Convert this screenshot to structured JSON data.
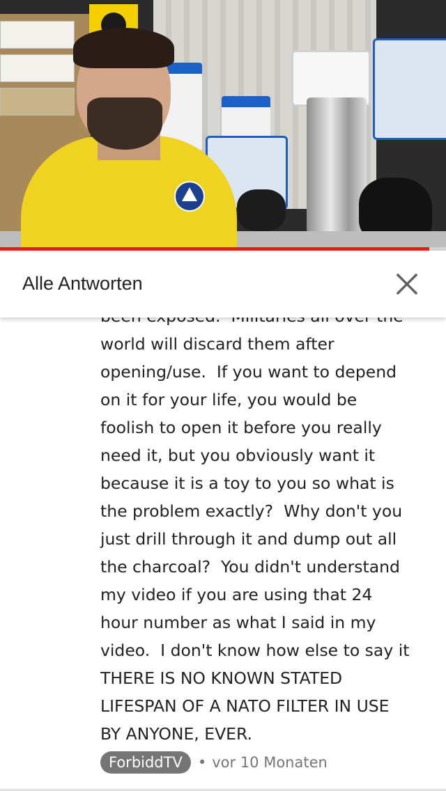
{
  "video": {
    "progress_fraction": 0.963,
    "progress_color": "#e62117"
  },
  "header": {
    "title": "Alle Antworten",
    "close_icon": "close-icon"
  },
  "comment": {
    "partial_top_line": "been exposed.  Militaries all over the",
    "lines": [
      "world will discard them after",
      "opening/use.  If you want to depend",
      "on it for your life, you would be",
      "foolish to open it before you really",
      "need it, but you obviously want it",
      "because it is a toy to you so what is",
      "the problem exactly?  Why don't you",
      "just drill through it and dump out all",
      "the charcoal?  You didn't understand",
      "my video if you are using that 24",
      "hour number as what I said in my",
      "video.  I don't know how else to say it",
      "THERE IS NO KNOWN STATED",
      "LIFESPAN OF A NATO FILTER IN USE",
      "BY ANYONE, EVER."
    ],
    "author": "ForbiddTV",
    "separator": "•",
    "time": "vor 10 Monaten"
  }
}
